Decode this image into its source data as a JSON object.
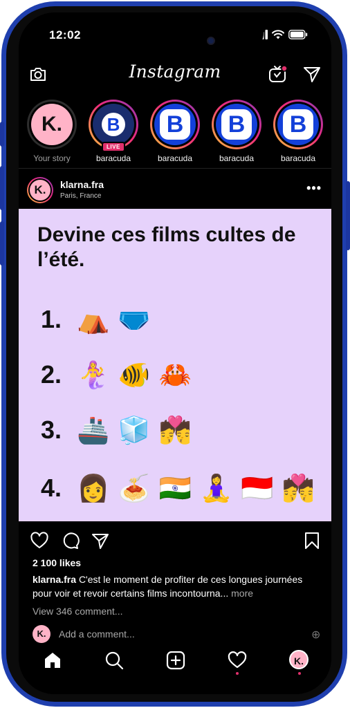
{
  "status_bar": {
    "time": "12:02"
  },
  "header": {
    "app_title": "Instagram"
  },
  "stories": [
    {
      "name": "Your story",
      "avatar_text": "K.",
      "own": true
    },
    {
      "name": "baracuda",
      "avatar_text": "B",
      "live": true,
      "live_label": "LIVE"
    },
    {
      "name": "baracuda",
      "avatar_text": "B"
    },
    {
      "name": "baracuda",
      "avatar_text": "B"
    },
    {
      "name": "baracuda",
      "avatar_text": "B"
    }
  ],
  "post": {
    "username": "klarna.fra",
    "location": "Paris, France",
    "avatar_text": "K.",
    "more_label": "•••",
    "image": {
      "title": "Devine ces films cultes de l’été.",
      "background": "#e6d2fb",
      "items": [
        {
          "number": "1.",
          "emojis": [
            "⛺",
            "🩲"
          ]
        },
        {
          "number": "2.",
          "emojis": [
            "🧜‍♀️",
            "🐠",
            "🦀"
          ]
        },
        {
          "number": "3.",
          "emojis": [
            "🚢",
            "🧊",
            "💏"
          ]
        },
        {
          "number": "4.",
          "emojis": [
            "👩",
            "🍝",
            "🇮🇳",
            "🧘‍♀️",
            "🇮🇩",
            "💏"
          ]
        }
      ]
    },
    "likes": "2 100 likes",
    "caption_user": "klarna.fra",
    "caption_text": "C'est le moment de profiter de ces longues journées pour voir et revoir certains films incontourna...",
    "caption_more": "more",
    "view_comments": "View 346 comment...",
    "add_comment_placeholder": "Add a comment...",
    "quick_emojis": [
      "😜",
      "😂",
      "⊕"
    ]
  },
  "colors": {
    "brand_blue": "#1340d9",
    "klarna_pink": "#ffb3c7",
    "notification": "#e1306c",
    "frame": "#1f3fae"
  },
  "icons": {
    "header": [
      "camera-icon",
      "igtv-icon",
      "direct-message-icon"
    ],
    "actions": [
      "heart-icon",
      "comment-icon",
      "share-icon",
      "bookmark-icon"
    ],
    "nav": [
      "home-icon",
      "search-icon",
      "new-post-icon",
      "activity-heart-icon",
      "profile-avatar-icon"
    ]
  }
}
